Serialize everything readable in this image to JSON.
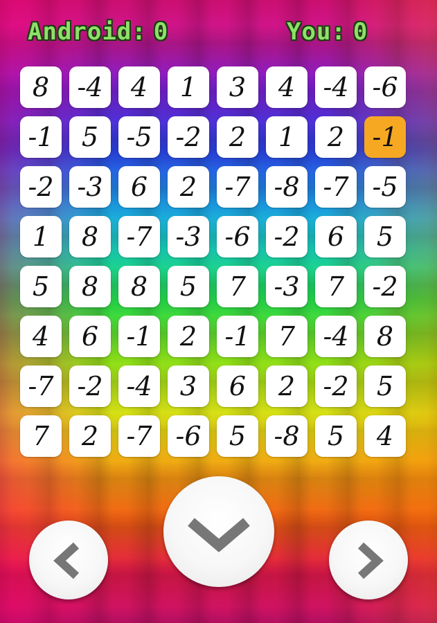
{
  "scores": {
    "android_label": "Android:",
    "android_value": "0",
    "you_label": "You:",
    "you_value": "0"
  },
  "board": {
    "rows": [
      [
        "8",
        "-4",
        "4",
        "1",
        "3",
        "4",
        "-4",
        "-6"
      ],
      [
        "-1",
        "5",
        "-5",
        "-2",
        "2",
        "1",
        "2",
        "-1"
      ],
      [
        "-2",
        "-3",
        "6",
        "2",
        "-7",
        "-8",
        "-7",
        "-5"
      ],
      [
        "1",
        "8",
        "-7",
        "-3",
        "-6",
        "-2",
        "6",
        "5"
      ],
      [
        "5",
        "8",
        "8",
        "5",
        "7",
        "-3",
        "7",
        "-2"
      ],
      [
        "4",
        "6",
        "-1",
        "2",
        "-1",
        "7",
        "-4",
        "8"
      ],
      [
        "-7",
        "-2",
        "-4",
        "3",
        "6",
        "2",
        "-2",
        "5"
      ],
      [
        "7",
        "2",
        "-7",
        "-6",
        "5",
        "-8",
        "5",
        "4"
      ]
    ],
    "selected": {
      "row": 1,
      "col": 7
    },
    "selected_color": "#f6a823",
    "cell_color": "#ffffff"
  },
  "controls": {
    "left": {
      "icon": "chevron-left-icon"
    },
    "down": {
      "icon": "chevron-down-icon"
    },
    "right": {
      "icon": "chevron-right-icon"
    }
  },
  "colors": {
    "score_text": "#8ee06a",
    "score_outline": "#1b3d10",
    "arrow": "#777777"
  }
}
